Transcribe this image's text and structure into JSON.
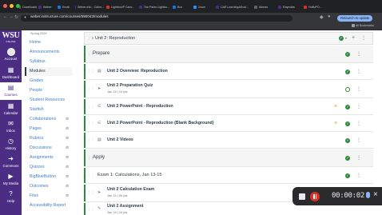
{
  "browser": {
    "tabs": [
      {
        "label": "Downloads",
        "color": "#5f6368"
      },
      {
        "label": "Weber",
        "color": "#4b2e83"
      },
      {
        "label": "Email",
        "color": "#1a73e8"
      },
      {
        "label": "Weber.edu - Calen...",
        "color": "#4b2e83"
      },
      {
        "label": "LightboxIP Canv...",
        "color": "#d93025"
      },
      {
        "label": "The Parks Lightbo...",
        "color": "#4b2e83"
      },
      {
        "label": "Box",
        "color": "#1a73e8"
      },
      {
        "label": "Zoom",
        "color": "#2d8cff"
      },
      {
        "label": "CAE Learning&Eval...",
        "color": "#4b2e83"
      },
      {
        "label": "Albeas",
        "color": "#5f6368"
      },
      {
        "label": "Raynolds",
        "color": "#4b2e83"
      },
      {
        "label": "HuffuPO...",
        "color": "#d93025"
      }
    ],
    "url": "weber.instructure.com/courses/590043/modules",
    "relaunch_label": "Relaunch to update",
    "bookmarks_label": "All Bookmarks"
  },
  "global_nav": {
    "logo_main": "WSU",
    "logo_sub": "ONLINE",
    "items": [
      {
        "label": "Account",
        "icon": "avatar"
      },
      {
        "label": "Dashboard",
        "icon": "dashboard-icon"
      },
      {
        "label": "Courses",
        "icon": "book-icon"
      },
      {
        "label": "Calendar",
        "icon": "calendar-icon"
      },
      {
        "label": "Inbox",
        "icon": "inbox-icon"
      },
      {
        "label": "History",
        "icon": "clock-icon"
      },
      {
        "label": "Commons",
        "icon": "commons-icon"
      },
      {
        "label": "My Media",
        "icon": "media-icon"
      },
      {
        "label": "Help",
        "icon": "help-icon"
      }
    ]
  },
  "course_nav": {
    "term": "Spring 2025",
    "items": [
      {
        "label": "Home",
        "hidden": false
      },
      {
        "label": "Announcements",
        "hidden": false
      },
      {
        "label": "Syllabus",
        "hidden": false
      },
      {
        "label": "Modules",
        "hidden": false
      },
      {
        "label": "Grades",
        "hidden": false
      },
      {
        "label": "People",
        "hidden": false
      },
      {
        "label": "Student Resources",
        "hidden": false
      },
      {
        "label": "Starfish",
        "hidden": false
      },
      {
        "label": "Collaborations",
        "hidden": true
      },
      {
        "label": "Pages",
        "hidden": true
      },
      {
        "label": "Rubrics",
        "hidden": true
      },
      {
        "label": "Discussions",
        "hidden": true
      },
      {
        "label": "Assignments",
        "hidden": true
      },
      {
        "label": "Quizzes",
        "hidden": true
      },
      {
        "label": "BigBlueButton",
        "hidden": true
      },
      {
        "label": "Outcomes",
        "hidden": true
      },
      {
        "label": "Files",
        "hidden": true
      },
      {
        "label": "Accessibility Report",
        "hidden": false
      }
    ],
    "active": "Modules"
  },
  "module": {
    "title": "Unit 2: Reproduction",
    "items": [
      {
        "title": "Prepare",
        "type": "header",
        "meta": "",
        "status": "published"
      },
      {
        "title": "Unit 2 Overview: Reproduction",
        "type": "page",
        "meta": "",
        "status": "published"
      },
      {
        "title": "Unit 2 Preparation Quiz",
        "type": "quiz",
        "meta": "Jan 15 | 10 pts",
        "status": "published"
      },
      {
        "title": "Unit 2 PowerPoint - Reproduction",
        "type": "file",
        "meta": "",
        "status": "published"
      },
      {
        "title": "Unit 2 PowerPoint - Reproduction (Blank Background)",
        "type": "file",
        "meta": "",
        "status": "published"
      },
      {
        "title": "Unit 2 Videos",
        "type": "page",
        "meta": "",
        "status": "published"
      },
      {
        "title": "Apply",
        "type": "header",
        "meta": "",
        "status": "published"
      },
      {
        "title": "Exam 1: Calculations, Jan 13-15",
        "type": "subheader",
        "meta": "",
        "status": "published"
      },
      {
        "title": "Unit 2 Calculation Exam",
        "type": "quiz",
        "meta": "Jan 15 | 50 pts",
        "status": "published"
      },
      {
        "title": "Unit 2 Assignment",
        "type": "assignment",
        "meta": "Jan 15 | 10 pts",
        "status": "published"
      }
    ]
  },
  "recorder": {
    "time": "00:00:02"
  }
}
